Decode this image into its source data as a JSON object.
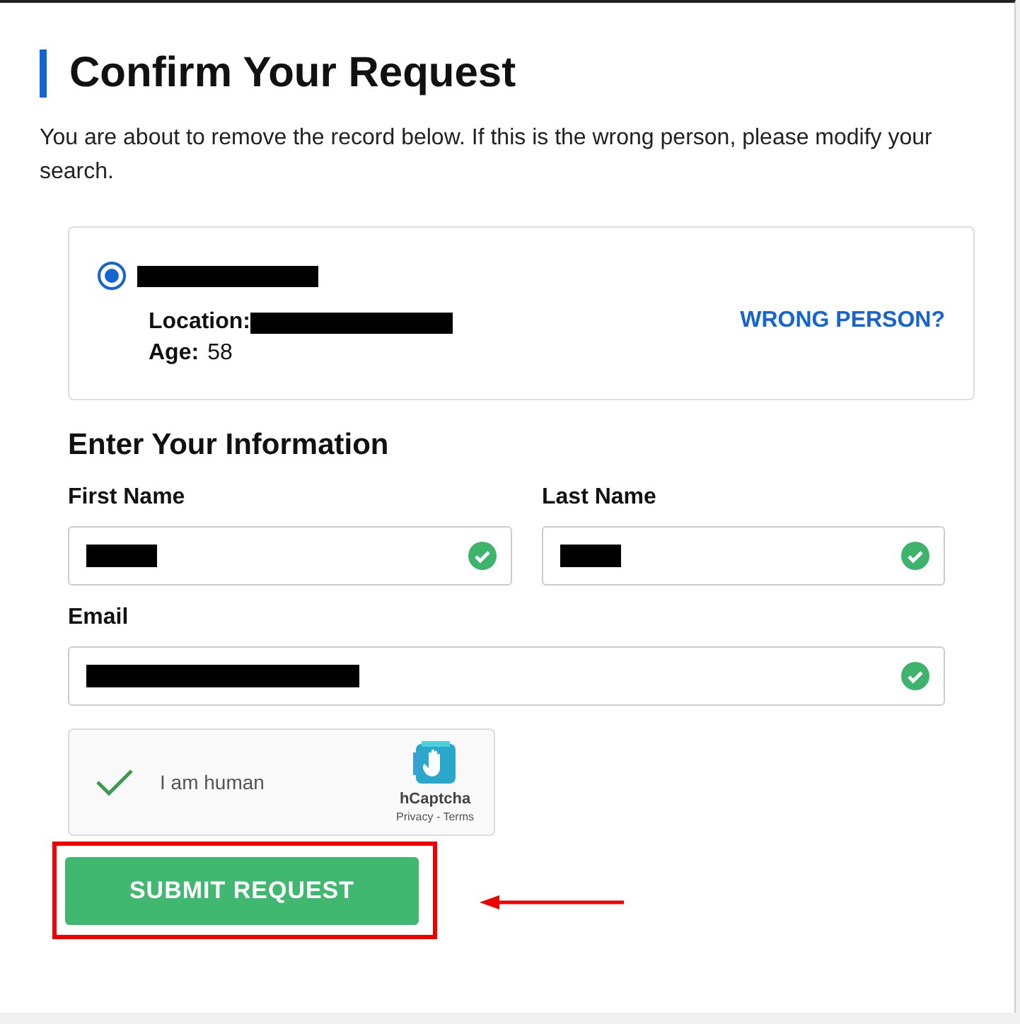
{
  "title": "Confirm Your Request",
  "intro": "You are about to remove the record below. If this is the wrong person, please modify your search.",
  "record": {
    "selected": true,
    "name_redacted": true,
    "location_label": "Location:",
    "location_redacted": true,
    "age_label": "Age:",
    "age": "58",
    "wrong_person_link": "WRONG PERSON?"
  },
  "section_title": "Enter Your Information",
  "fields": [
    {
      "label": "First Name",
      "redacted": true,
      "valid": true
    },
    {
      "label": "Last Name",
      "redacted": true,
      "valid": true
    },
    {
      "label": "Email",
      "redacted": true,
      "valid": true
    }
  ],
  "captcha": {
    "checked": true,
    "label": "I am human",
    "brand": "hCaptcha",
    "links": "Privacy - Terms"
  },
  "submit_button": "SUBMIT REQUEST",
  "annotation": {
    "highlighted": true,
    "arrow": true
  }
}
